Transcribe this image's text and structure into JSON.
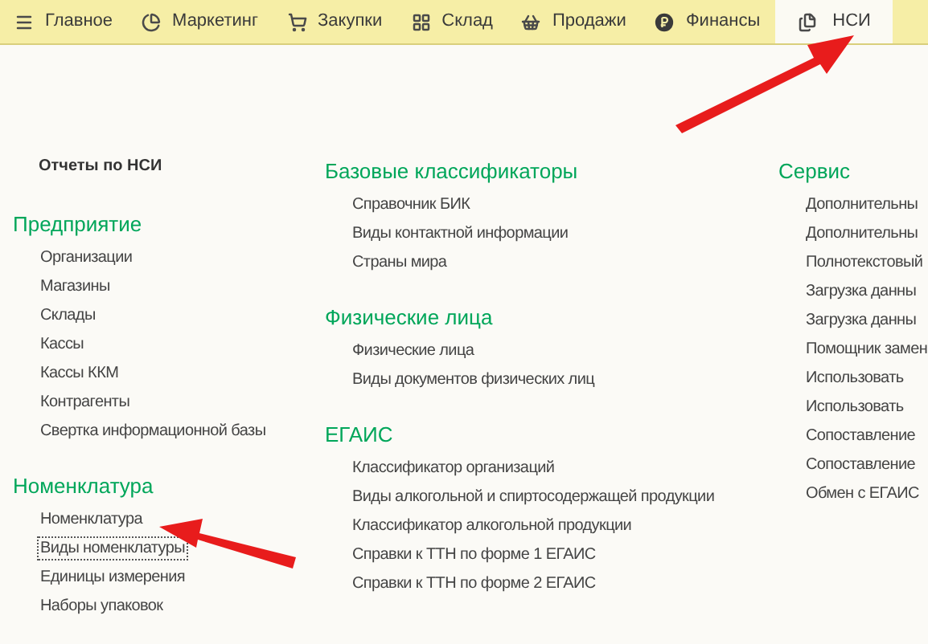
{
  "menu_bar": {
    "tabs": [
      {
        "label": "Главное",
        "kind": "menu",
        "selected": false
      },
      {
        "label": "Маркетинг",
        "kind": "pie",
        "selected": false
      },
      {
        "label": "Закупки",
        "kind": "cart",
        "selected": false
      },
      {
        "label": "Склад",
        "kind": "grid",
        "selected": false
      },
      {
        "label": "Продажи",
        "kind": "basket",
        "selected": false
      },
      {
        "label": "Финансы",
        "kind": "coin",
        "selected": false
      },
      {
        "label": "НСИ",
        "kind": "docs",
        "selected": true
      }
    ]
  },
  "columns": [
    {
      "header": "Отчеты по НСИ",
      "groups": [
        {
          "title": "Предприятие",
          "items": [
            {
              "label": "Организации",
              "focused": false
            },
            {
              "label": "Магазины",
              "focused": false
            },
            {
              "label": "Склады",
              "focused": false
            },
            {
              "label": "Кассы",
              "focused": false
            },
            {
              "label": "Кассы ККМ",
              "focused": false
            },
            {
              "label": "Контрагенты",
              "focused": false
            },
            {
              "label": "Свертка информационной базы",
              "focused": false
            }
          ]
        },
        {
          "title": "Номенклатура",
          "items": [
            {
              "label": "Номенклатура",
              "focused": false
            },
            {
              "label": "Виды номенклатуры",
              "focused": true
            },
            {
              "label": "Единицы измерения",
              "focused": false
            },
            {
              "label": "Наборы упаковок",
              "focused": false
            }
          ]
        }
      ]
    },
    {
      "groups": [
        {
          "title": "Базовые классификаторы",
          "items": [
            {
              "label": "Справочник БИК",
              "focused": false
            },
            {
              "label": "Виды контактной информации",
              "focused": false
            },
            {
              "label": "Страны мира",
              "focused": false
            }
          ]
        },
        {
          "title": "Физические лица",
          "items": [
            {
              "label": "Физические лица",
              "focused": false
            },
            {
              "label": "Виды документов физических лиц",
              "focused": false
            }
          ]
        },
        {
          "title": "ЕГАИС",
          "items": [
            {
              "label": "Классификатор организаций",
              "focused": false
            },
            {
              "label": "Виды алкогольной и спиртосодержащей продукции",
              "focused": false
            },
            {
              "label": "Классификатор алкогольной продукции",
              "focused": false
            },
            {
              "label": "Справки к ТТН по форме 1 ЕГАИС",
              "focused": false
            },
            {
              "label": "Справки к ТТН по форме 2 ЕГАИС",
              "focused": false
            }
          ]
        }
      ]
    },
    {
      "groups": [
        {
          "title": "Сервис",
          "items": [
            {
              "label": "Дополнительны",
              "focused": false
            },
            {
              "label": "Дополнительны",
              "focused": false
            },
            {
              "label": "Полнотекстовый",
              "focused": false
            },
            {
              "label": "Загрузка данны",
              "focused": false
            },
            {
              "label": "Загрузка данны",
              "focused": false
            },
            {
              "label": "Помощник замен",
              "focused": false
            },
            {
              "label": "Использовать",
              "focused": false
            },
            {
              "label": "Использовать",
              "focused": false
            },
            {
              "label": "Сопоставление",
              "focused": false
            },
            {
              "label": "Сопоставление",
              "focused": false
            },
            {
              "label": "Обмен с ЕГАИС",
              "focused": false
            }
          ]
        }
      ]
    }
  ]
}
